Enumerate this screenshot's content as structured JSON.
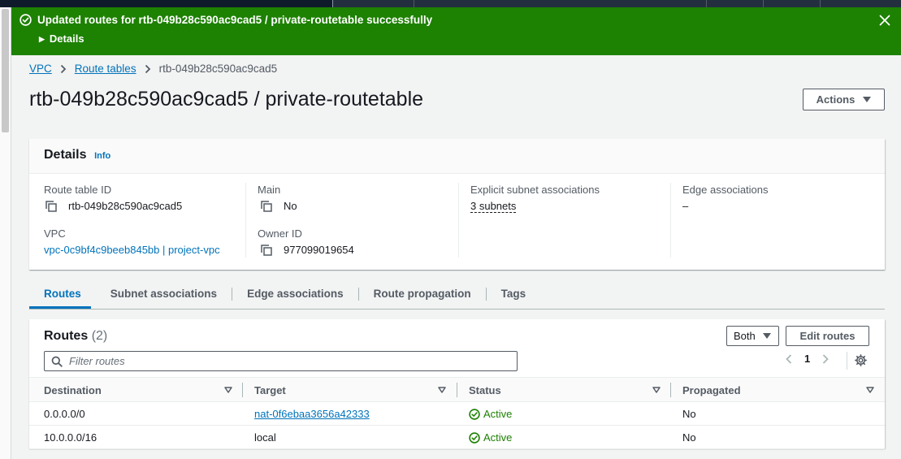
{
  "flash": {
    "message": "Updated routes for rtb-049b28c590ac9cad5 / private-routetable successfully",
    "details_label": "Details",
    "color": "#1d8102"
  },
  "breadcrumb": {
    "items": [
      "VPC",
      "Route tables",
      "rtb-049b28c590ac9cad5"
    ]
  },
  "page": {
    "title": "rtb-049b28c590ac9cad5 / private-routetable",
    "actions_label": "Actions"
  },
  "details": {
    "heading": "Details",
    "info_label": "Info",
    "route_table_id_label": "Route table ID",
    "route_table_id": "rtb-049b28c590ac9cad5",
    "vpc_label": "VPC",
    "vpc_value": "vpc-0c9bf4c9beeb845bb | project-vpc",
    "main_label": "Main",
    "main_value": "No",
    "owner_label": "Owner ID",
    "owner_value": "977099019654",
    "explicit_label": "Explicit subnet associations",
    "explicit_value": "3 subnets",
    "edge_label": "Edge associations",
    "edge_value": "–"
  },
  "tabs": [
    "Routes",
    "Subnet associations",
    "Edge associations",
    "Route propagation",
    "Tags"
  ],
  "routes": {
    "title": "Routes",
    "count": "(2)",
    "filter_select": "Both",
    "edit_label": "Edit routes",
    "filter_placeholder": "Filter routes",
    "page": "1",
    "columns": [
      "Destination",
      "Target",
      "Status",
      "Propagated"
    ],
    "rows": [
      {
        "destination": "0.0.0.0/0",
        "target": "nat-0f6ebaa3656a42333",
        "status": "Active",
        "propagated": "No"
      },
      {
        "destination": "10.0.0.0/16",
        "target": "local",
        "status": "Active",
        "propagated": "No"
      }
    ]
  },
  "colors": {
    "accent": "#0073bb",
    "success": "#1d8102",
    "header": "#232f3e"
  },
  "icons": [
    "check-circle-icon",
    "close-icon",
    "caret-right-icon",
    "chevron-right-icon",
    "copy-icon",
    "caret-down-icon",
    "search-icon",
    "chevron-left-icon",
    "gear-icon",
    "sort-icon"
  ]
}
